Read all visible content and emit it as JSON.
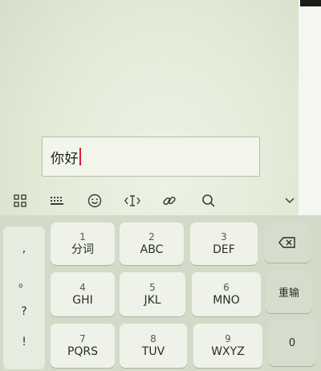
{
  "input": {
    "text": "你好"
  },
  "toolbar": {
    "icons": [
      "grid-icon",
      "keyboard-icon",
      "emoji-icon",
      "cursor-icon",
      "link-icon",
      "search-icon",
      "chevron-down-icon"
    ]
  },
  "keyboard": {
    "punctuation": [
      ",",
      "。",
      "?",
      "!"
    ],
    "keys": [
      {
        "num": "1",
        "letters": "分词"
      },
      {
        "num": "2",
        "letters": "ABC"
      },
      {
        "num": "3",
        "letters": "DEF"
      },
      {
        "num": "4",
        "letters": "GHI"
      },
      {
        "num": "5",
        "letters": "JKL"
      },
      {
        "num": "6",
        "letters": "MNO"
      },
      {
        "num": "7",
        "letters": "PQRS"
      },
      {
        "num": "8",
        "letters": "TUV"
      },
      {
        "num": "9",
        "letters": "WXYZ"
      }
    ],
    "enter_label": "重输",
    "zero_label": "0"
  }
}
